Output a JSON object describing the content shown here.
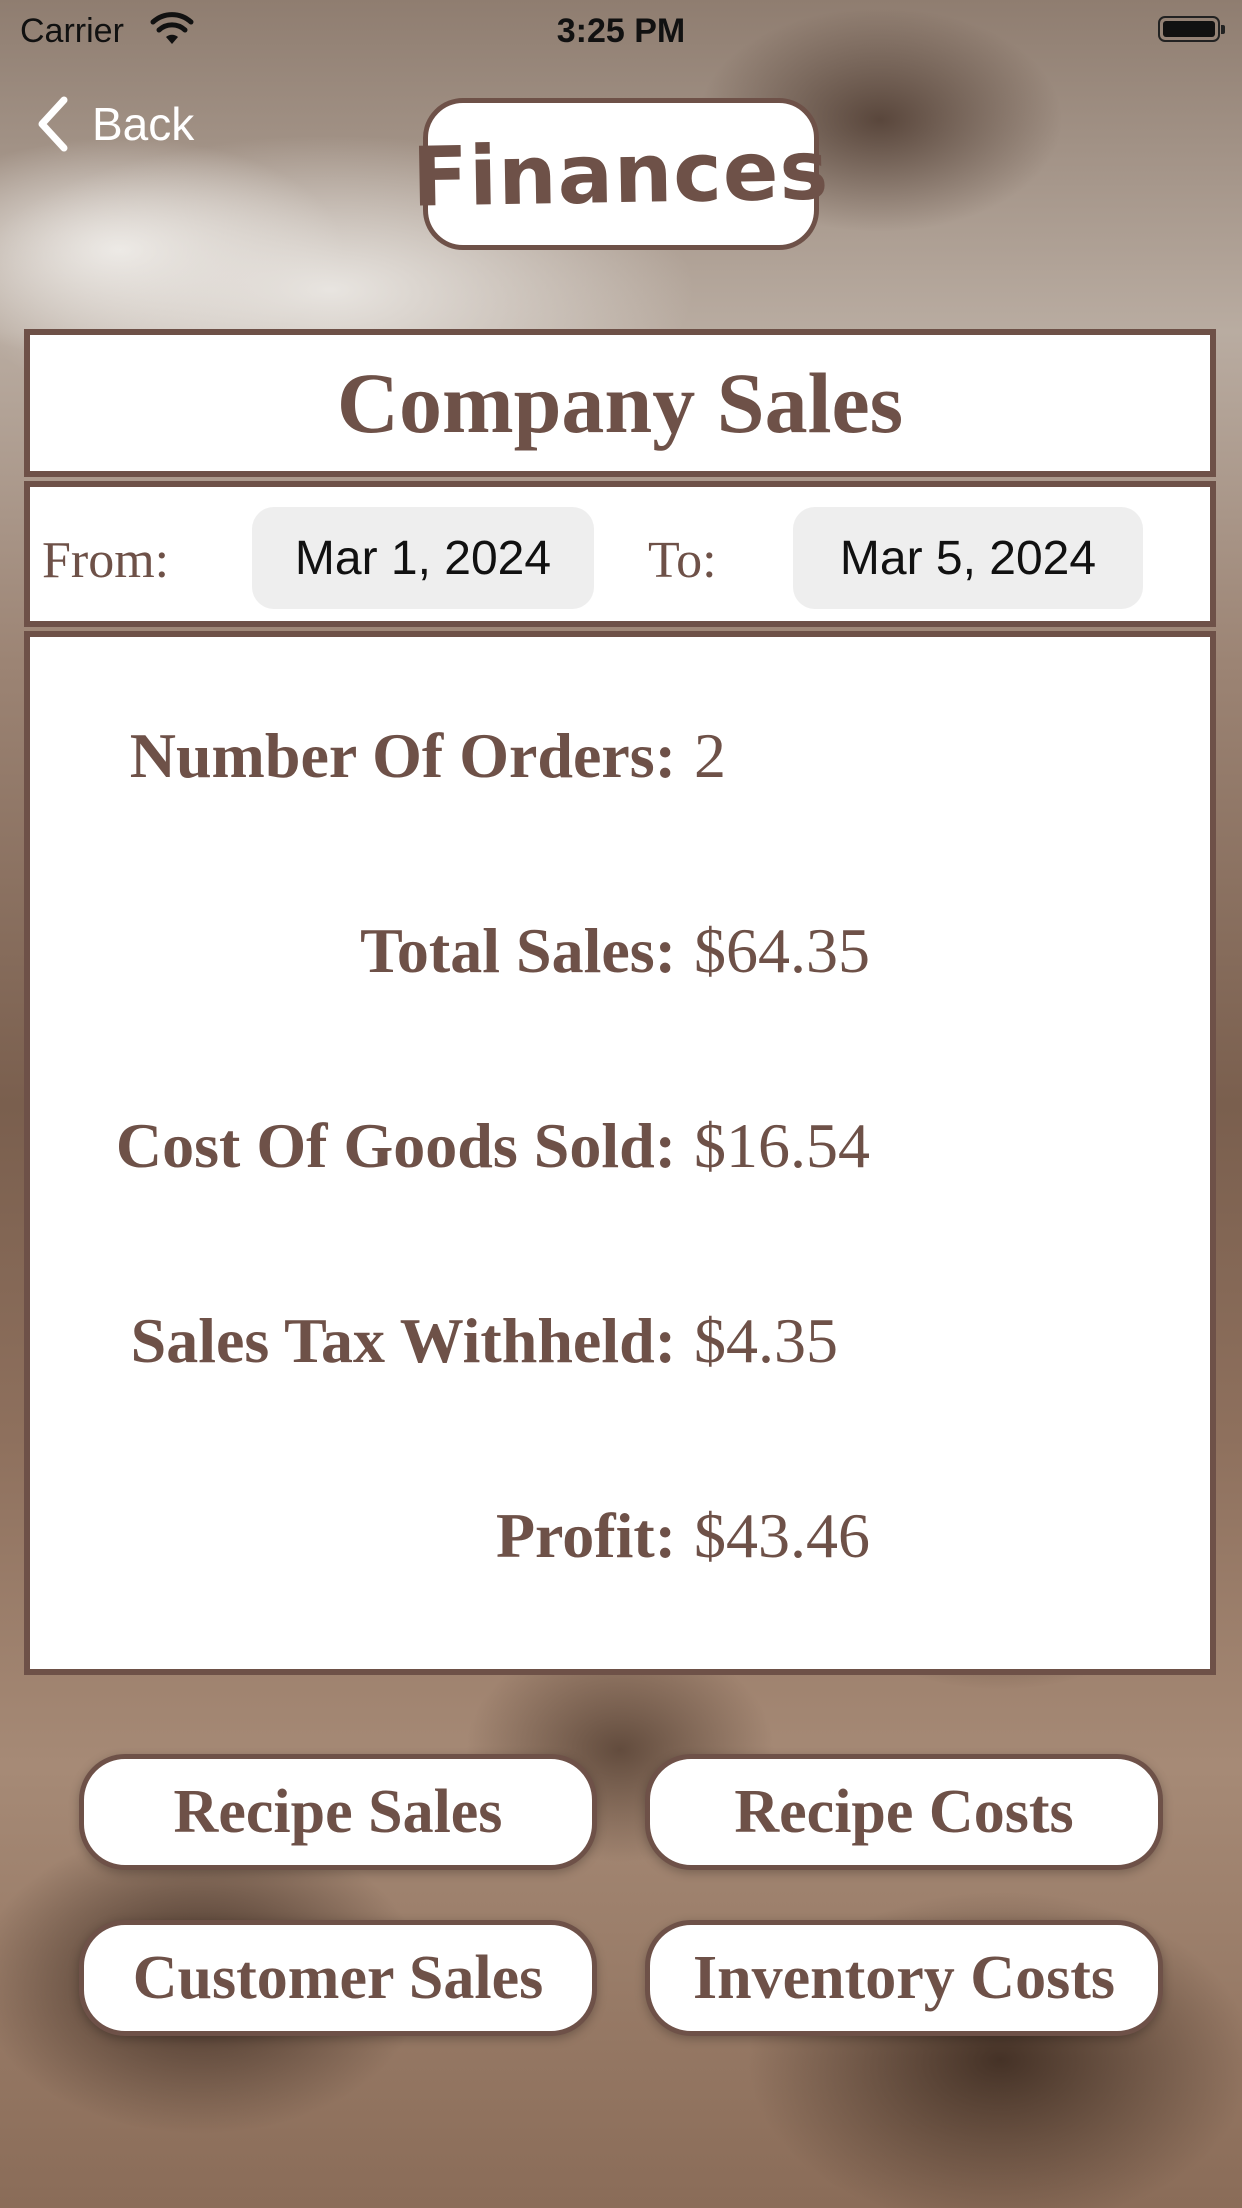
{
  "status_bar": {
    "carrier": "Carrier",
    "time": "3:25 PM"
  },
  "nav": {
    "back_label": "Back",
    "title": "Finances"
  },
  "sales": {
    "heading": "Company Sales",
    "from_label": "From:",
    "from_date": "Mar 1, 2024",
    "to_label": "To:",
    "to_date": "Mar 5, 2024",
    "stats": [
      {
        "label": "Number Of Orders:",
        "value": "2"
      },
      {
        "label": "Total Sales:",
        "value": "$64.35"
      },
      {
        "label": "Cost Of Goods Sold:",
        "value": "$16.54"
      },
      {
        "label": "Sales Tax Withheld:",
        "value": "$4.35"
      },
      {
        "label": "Profit:",
        "value": "$43.46"
      }
    ]
  },
  "buttons": {
    "recipe_sales": "Recipe Sales",
    "recipe_costs": "Recipe Costs",
    "customer_sales": "Customer Sales",
    "inventory_costs": "Inventory Costs"
  },
  "colors": {
    "accent": "#6e5148",
    "panel": "#ffffff",
    "chip": "#eeeeee"
  }
}
